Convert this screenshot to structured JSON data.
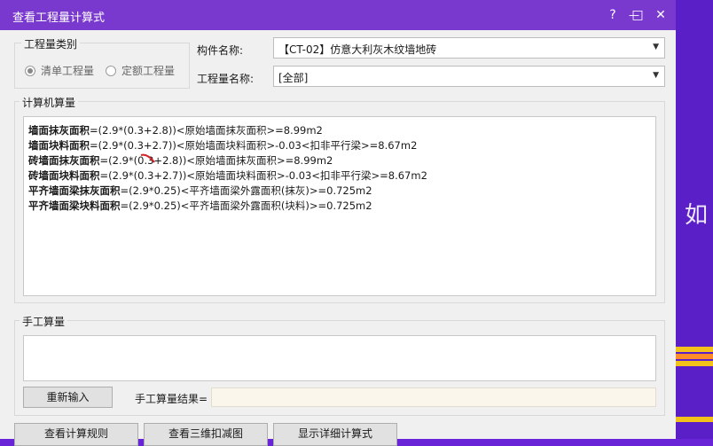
{
  "window": {
    "title": "查看工程量计算式",
    "buttons": {
      "help": "?",
      "minimize": "—",
      "maximize": "□",
      "close": "✕"
    }
  },
  "quantity_type": {
    "legend": "工程量类别",
    "options": [
      {
        "label": "清单工程量",
        "selected": true
      },
      {
        "label": "定额工程量",
        "selected": false
      }
    ]
  },
  "component": {
    "label": "构件名称:",
    "value": "【CT-02】仿意大利灰木纹墙地砖"
  },
  "quantity_name": {
    "label": "工程量名称:",
    "value": "[全部]"
  },
  "computed": {
    "legend": "计算机算量",
    "lines": [
      {
        "name": "墙面抹灰面积",
        "formula": "=(2.9*(0.3+2.8))<原始墙面抹灰面积>=8.99m2"
      },
      {
        "name": "墙面块料面积",
        "formula": "=(2.9*(0.3+2.7))<原始墙面块料面积>-0.03<扣非平行梁>=8.67m2"
      },
      {
        "name": "砖墙面抹灰面积",
        "formula": "=(2.9*(0.3+2.8))<原始墙面抹灰面积>=8.99m2"
      },
      {
        "name": "砖墙面块料面积",
        "formula": "=(2.9*(0.3+2.7))<原始墙面块料面积>-0.03<扣非平行梁>=8.67m2"
      },
      {
        "name": "平齐墙面梁抹灰面积",
        "formula": "=(2.9*0.25)<平齐墙面梁外露面积(抹灰)>=0.725m2"
      },
      {
        "name": "平齐墙面梁块料面积",
        "formula": "=(2.9*0.25)<平齐墙面梁外露面积(块料)>=0.725m2"
      }
    ]
  },
  "manual": {
    "legend": "手工算量",
    "reset_label": "重新输入",
    "result_label": "手工算量结果=",
    "result_value": ""
  },
  "bottom_buttons": {
    "rules": "查看计算规则",
    "view3d": "查看三维扣减图",
    "detail": "显示详细计算式"
  },
  "background": {
    "text": "如"
  },
  "colors": {
    "titlebar": "#7a39ce",
    "desktop": "#6a24d8"
  }
}
